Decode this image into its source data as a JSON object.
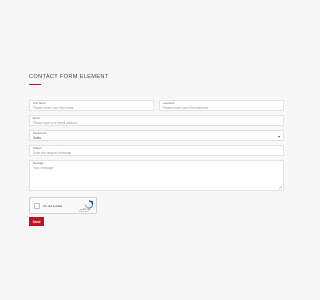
{
  "form": {
    "title": "CONTACT FORM ELEMENT",
    "accent_color": "#c1121f",
    "first_name": {
      "label": "First Name",
      "placeholder": "Please insert your first name"
    },
    "last_name": {
      "label": "Lastname",
      "placeholder": "Please insert your first lastname"
    },
    "email": {
      "label": "Email",
      "placeholder": "Please type your email address"
    },
    "department": {
      "label": "Department",
      "selected": "Sales"
    },
    "subject": {
      "label": "Subject",
      "placeholder": "Enter the request message"
    },
    "message": {
      "label": "Message",
      "placeholder": "Your message"
    },
    "recaptcha": {
      "checkbox_label": "I'm not a robot",
      "brand": "reCAPTCHA",
      "terms": "Privacy - Terms"
    },
    "submit_label": "Send"
  }
}
